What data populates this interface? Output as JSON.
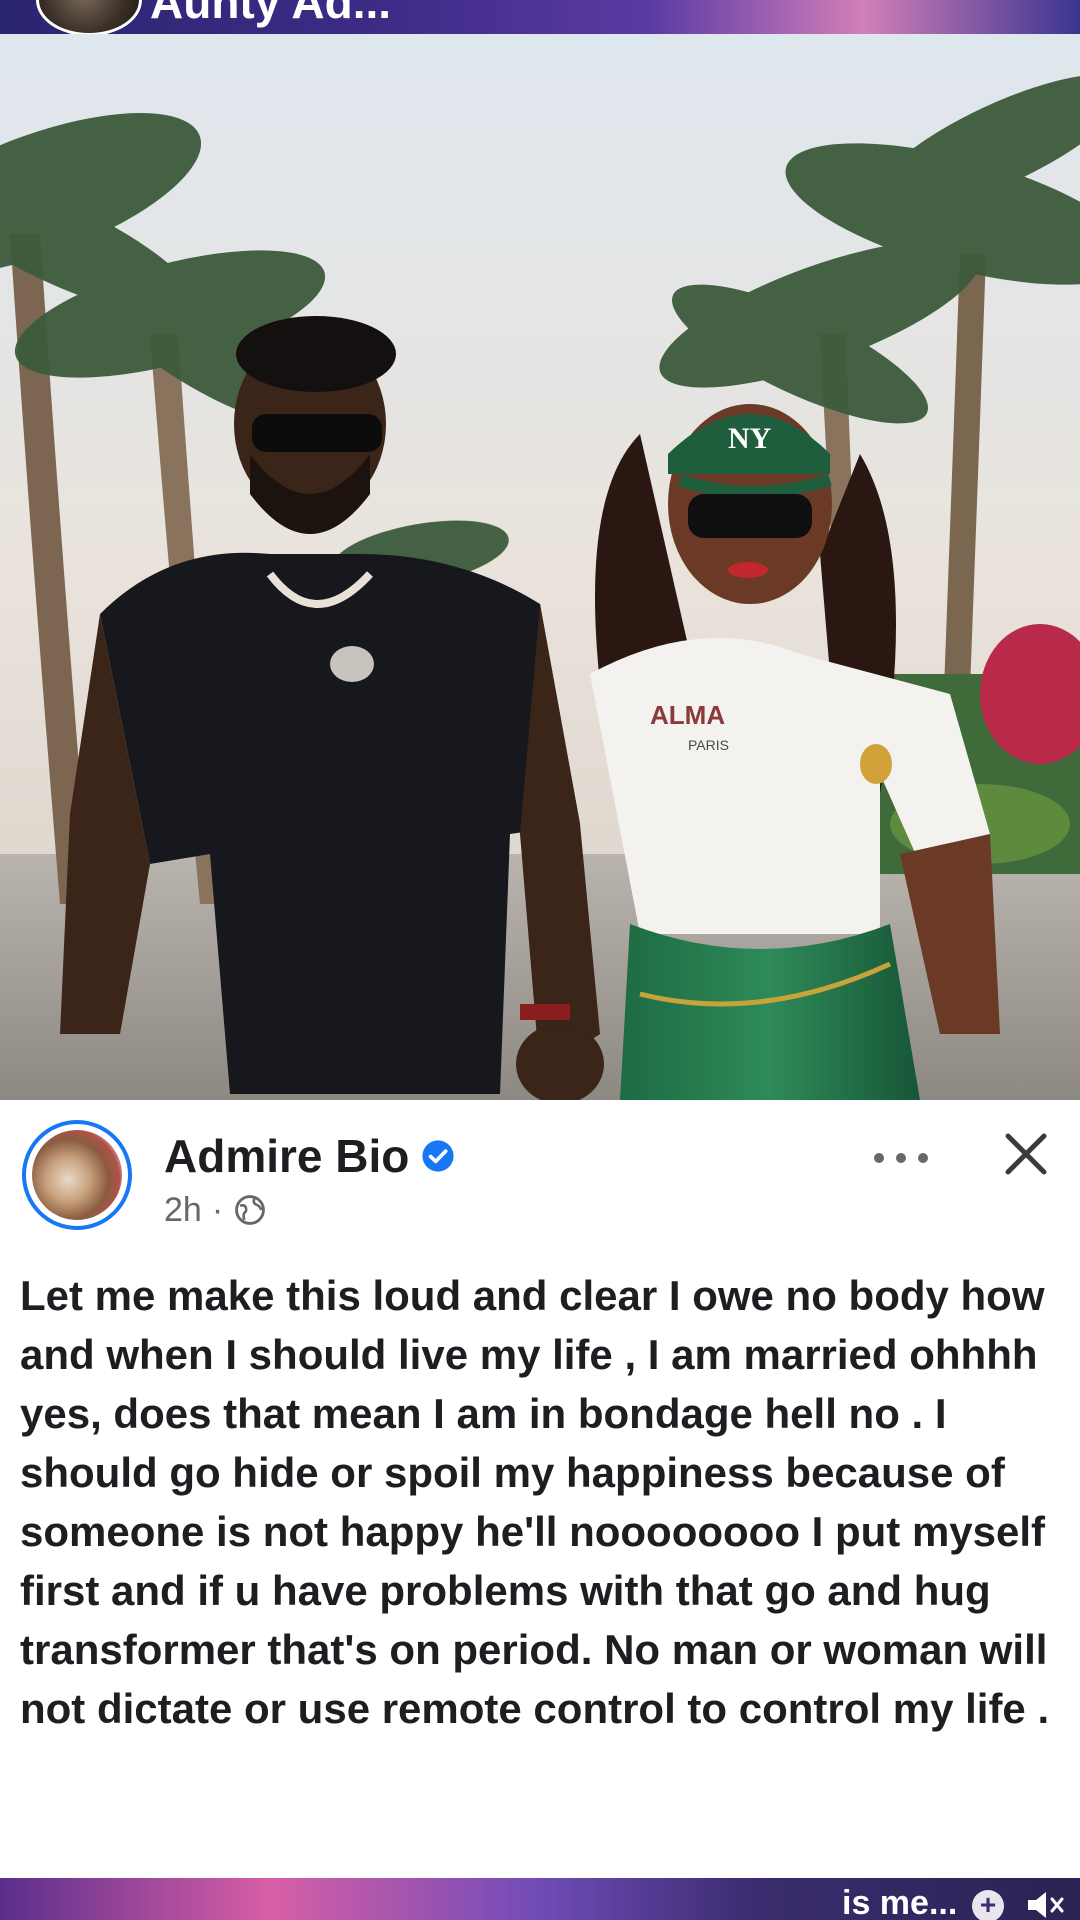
{
  "story_header": {
    "title": "Aunty Ad..."
  },
  "photo": {
    "cap_text": "NY",
    "shirt_text": "ALMA",
    "shirt_subtext": "PARIS"
  },
  "post": {
    "author_name": "Admire Bio",
    "verified": true,
    "timestamp": "2h",
    "meta_separator": "·",
    "audience_icon": "globe-icon",
    "more_icon": "more-dots-icon",
    "close_icon": "close-icon",
    "body": "Let me make this loud and clear I owe no body how and when I should live my life , I am married ohhhh yes, does that mean I am in bondage hell no . I should go hide or spoil my happiness because of someone is not happy he'll noooooooo I put myself first and if u have problems with that go and hug transformer that's on period. No man or woman will not dictate or use remote control to control my life ."
  },
  "bottom_strip": {
    "next_label": "is me...",
    "plus_label": "+"
  },
  "colors": {
    "brand_blue": "#1877f2",
    "text_primary": "#1c1e21",
    "text_secondary": "#65676b"
  }
}
